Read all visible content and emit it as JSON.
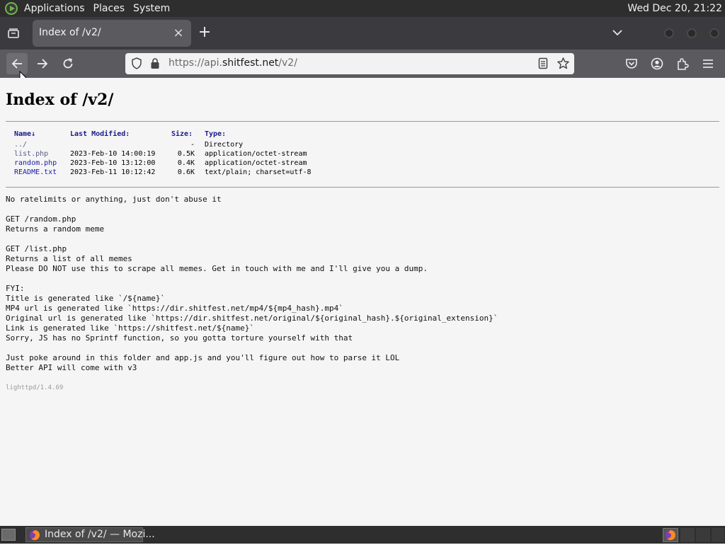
{
  "top_panel": {
    "menus": [
      "Applications",
      "Places",
      "System"
    ],
    "clock": "Wed Dec 20, 21:22"
  },
  "browser": {
    "tab_title": "Index of /v2/",
    "url_prefix": "https://api.",
    "url_host": "shitfest.net",
    "url_path": "/v2/"
  },
  "page": {
    "heading": "Index of /v2/",
    "table": {
      "headers": [
        "Name↓",
        "Last Modified:",
        "Size:",
        "Type:"
      ],
      "rows": [
        {
          "name": "../",
          "modified": "",
          "size": "-",
          "type": "Directory"
        },
        {
          "name": "list.php",
          "modified": "2023-Feb-10 14:00:19",
          "size": "0.5K",
          "type": "application/octet-stream"
        },
        {
          "name": "random.php",
          "modified": "2023-Feb-10 13:12:00",
          "size": "0.4K",
          "type": "application/octet-stream"
        },
        {
          "name": "README.txt",
          "modified": "2023-Feb-11 10:12:42",
          "size": "0.6K",
          "type": "text/plain; charset=utf-8"
        }
      ]
    },
    "readme": "No ratelimits or anything, just don't abuse it\n\nGET /random.php\nReturns a random meme\n\nGET /list.php\nReturns a list of all memes\nPlease DO NOT use this to scrape all memes. Get in touch with me and I'll give you a dump.\n\nFYI:\nTitle is generated like `/${name}`\nMP4 url is generated like `https://dir.shitfest.net/mp4/${mp4_hash}.mp4`\nOriginal url is generated like `https://dir.shitfest.net/original/${original_hash}.${original_extension}`\nLink is generated like `https://shitfest.net/${name}`\nSorry, JS has no Sprintf function, so you gotta torture yourself with that\n\nJust poke around in this folder and app.js and you'll figure out how to parse it LOL\nBetter API will come with v3",
    "server_signature": "lighttpd/1.4.69"
  },
  "taskbar": {
    "window_label": "Index of /v2/ — Mozi..."
  },
  "colors": {
    "panel": "#2e2e2e",
    "tab_strip": "#3b3b3f",
    "toolbar": "#5b5b5f",
    "link": "#1a1aa8",
    "visited_link": "#5a5a8a",
    "header_text": "#1a1a8c"
  },
  "icons": [
    "gnome-foot-icon",
    "list-tabs-icon",
    "close-icon",
    "plus-icon",
    "chevron-down-icon",
    "back-arrow-icon",
    "forward-arrow-icon",
    "reload-icon",
    "shield-icon",
    "lock-icon",
    "reader-view-icon",
    "star-icon",
    "pocket-icon",
    "account-icon",
    "extensions-icon",
    "hamburger-menu-icon",
    "firefox-icon",
    "show-desktop-icon"
  ]
}
